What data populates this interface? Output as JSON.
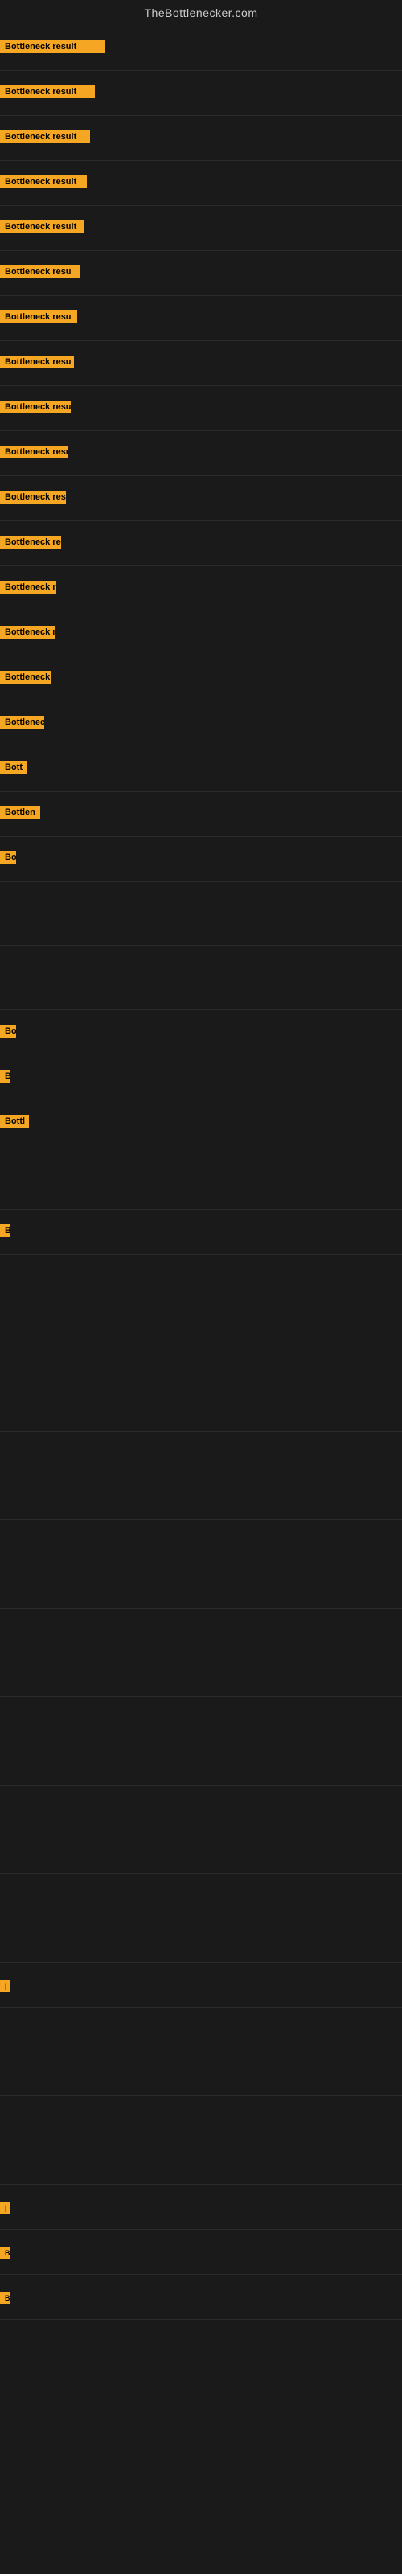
{
  "site": {
    "title": "TheBottlenecker.com"
  },
  "rows": [
    {
      "label": "Bottleneck result",
      "badgeWidth": 130,
      "height": 56,
      "fontSize": 11
    },
    {
      "label": "Bottleneck result",
      "badgeWidth": 120,
      "height": 56,
      "fontSize": 11
    },
    {
      "label": "Bottleneck result",
      "badgeWidth": 115,
      "height": 56,
      "fontSize": 11
    },
    {
      "label": "Bottleneck result",
      "badgeWidth": 110,
      "height": 56,
      "fontSize": 11
    },
    {
      "label": "Bottleneck result",
      "badgeWidth": 108,
      "height": 56,
      "fontSize": 11
    },
    {
      "label": "Bottleneck resu",
      "badgeWidth": 102,
      "height": 56,
      "fontSize": 11
    },
    {
      "label": "Bottleneck resu",
      "badgeWidth": 100,
      "height": 56,
      "fontSize": 11
    },
    {
      "label": "Bottleneck resu",
      "badgeWidth": 96,
      "height": 56,
      "fontSize": 11
    },
    {
      "label": "Bottleneck resu",
      "badgeWidth": 92,
      "height": 56,
      "fontSize": 11
    },
    {
      "label": "Bottleneck resu",
      "badgeWidth": 88,
      "height": 56,
      "fontSize": 11
    },
    {
      "label": "Bottleneck resu",
      "badgeWidth": 84,
      "height": 56,
      "fontSize": 11
    },
    {
      "label": "Bottleneck res",
      "badgeWidth": 80,
      "height": 56,
      "fontSize": 11
    },
    {
      "label": "Bottleneck re",
      "badgeWidth": 75,
      "height": 56,
      "fontSize": 11
    },
    {
      "label": "Bottleneck res",
      "badgeWidth": 72,
      "height": 56,
      "fontSize": 11
    },
    {
      "label": "Bottleneck re",
      "badgeWidth": 68,
      "height": 56,
      "fontSize": 11
    },
    {
      "label": "Bottlenec",
      "badgeWidth": 58,
      "height": 56,
      "fontSize": 11
    },
    {
      "label": "Bott",
      "badgeWidth": 36,
      "height": 56,
      "fontSize": 11
    },
    {
      "label": "Bottlen",
      "badgeWidth": 52,
      "height": 56,
      "fontSize": 11
    },
    {
      "label": "Bo",
      "badgeWidth": 22,
      "height": 56,
      "fontSize": 11
    },
    {
      "label": "",
      "badgeWidth": 0,
      "height": 80,
      "fontSize": 11
    },
    {
      "label": "",
      "badgeWidth": 0,
      "height": 80,
      "fontSize": 11
    },
    {
      "label": "Bo",
      "badgeWidth": 22,
      "height": 56,
      "fontSize": 11
    },
    {
      "label": "B",
      "badgeWidth": 14,
      "height": 56,
      "fontSize": 11
    },
    {
      "label": "Bottl",
      "badgeWidth": 38,
      "height": 56,
      "fontSize": 11
    },
    {
      "label": "",
      "badgeWidth": 0,
      "height": 80,
      "fontSize": 11
    },
    {
      "label": "B",
      "badgeWidth": 14,
      "height": 56,
      "fontSize": 11
    },
    {
      "label": "",
      "badgeWidth": 0,
      "height": 110,
      "fontSize": 11
    },
    {
      "label": "",
      "badgeWidth": 0,
      "height": 110,
      "fontSize": 11
    },
    {
      "label": "",
      "badgeWidth": 0,
      "height": 110,
      "fontSize": 11
    },
    {
      "label": "",
      "badgeWidth": 0,
      "height": 110,
      "fontSize": 11
    },
    {
      "label": "",
      "badgeWidth": 0,
      "height": 110,
      "fontSize": 11
    },
    {
      "label": "",
      "badgeWidth": 0,
      "height": 110,
      "fontSize": 11
    },
    {
      "label": "",
      "badgeWidth": 0,
      "height": 110,
      "fontSize": 11
    },
    {
      "label": "",
      "badgeWidth": 0,
      "height": 110,
      "fontSize": 11
    },
    {
      "label": "|",
      "badgeWidth": 8,
      "height": 56,
      "fontSize": 9
    },
    {
      "label": "",
      "badgeWidth": 0,
      "height": 110,
      "fontSize": 11
    },
    {
      "label": "",
      "badgeWidth": 0,
      "height": 110,
      "fontSize": 11
    },
    {
      "label": "|",
      "badgeWidth": 8,
      "height": 56,
      "fontSize": 9
    },
    {
      "label": "B",
      "badgeWidth": 12,
      "height": 56,
      "fontSize": 9
    },
    {
      "label": "B",
      "badgeWidth": 12,
      "height": 56,
      "fontSize": 9
    }
  ]
}
